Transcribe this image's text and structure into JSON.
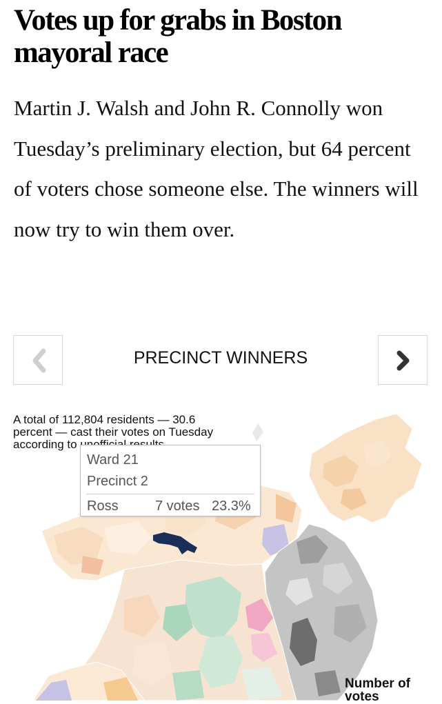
{
  "article": {
    "headline": "Votes up for grabs in Boston mayoral race",
    "dek": "Martin J. Walsh and John R. Connolly won Tuesday’s preliminary election, but 64 percent of voters chose someone else. The winners will now try to win them over."
  },
  "slideshow": {
    "title": "PRECINCT WINNERS",
    "prev_icon": "chevron-left-icon",
    "next_icon": "chevron-right-icon"
  },
  "map": {
    "caption": "A total of 112,804 residents — 30.6 percent — cast their votes on Tuesday according to unofficial results.",
    "legend_title": "Number of votes",
    "highlight_color": "#1b2e57",
    "tooltip": {
      "ward": "Ward 21",
      "precinct": "Precinct 2",
      "candidate": "Ross",
      "votes": "7 votes",
      "percent": "23.3%"
    }
  },
  "colors": {
    "orange_tint": "#f7d7b2",
    "green_tint": "#bfe0cc",
    "pink_tint": "#f4b6c8",
    "purple_tint": "#c6c2e4",
    "gray_tint": "#b8b8b8"
  }
}
